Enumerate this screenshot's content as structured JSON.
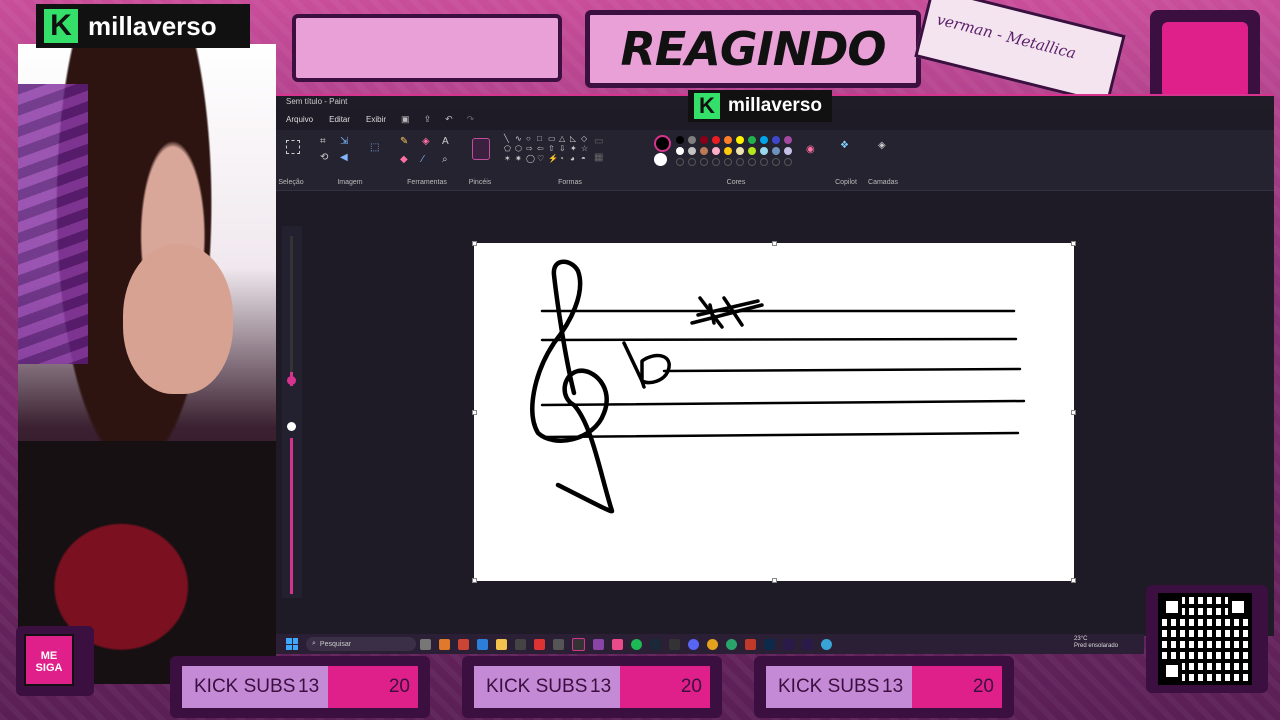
{
  "overlay": {
    "brand": "millaverso",
    "banner": "REAGINDO",
    "sticker_text": "verman - Metallica",
    "me_siga": "ME SIGA",
    "subs": [
      {
        "label": "KICK SUBS",
        "count": "13",
        "goal": "20"
      },
      {
        "label": "KICK SUBS",
        "count": "13",
        "goal": "20"
      },
      {
        "label": "KICK SUBS",
        "count": "13",
        "goal": "20"
      }
    ],
    "colors": {
      "accent": "#e0208a",
      "frame": "#3b0f3f",
      "panel": "#e9a0d6",
      "kick_green": "#35e06a"
    }
  },
  "paint": {
    "title": "Sem título - Paint",
    "menu": [
      "Arquivo",
      "Editar",
      "Exibir"
    ],
    "ribbon_groups": [
      "Seleção",
      "Imagem",
      "Ferramentas",
      "Pincéis",
      "Formas",
      "Cores",
      "Copilot",
      "Camadas"
    ],
    "palette": [
      "#000000",
      "#7f7f7f",
      "#880015",
      "#ed1c24",
      "#ff7f27",
      "#fff200",
      "#22b14c",
      "#00a2e8",
      "#3f48cc",
      "#a349a4",
      "#ffffff",
      "#c3c3c3",
      "#b97a57",
      "#ffaec9",
      "#ffc90e",
      "#efe4b0",
      "#b5e61d",
      "#99d9ea",
      "#7092be",
      "#c8bfe7"
    ],
    "icons": [
      "selection-icon",
      "crop-icon",
      "resize-icon",
      "rotate-icon",
      "pencil-icon",
      "fill-icon",
      "text-icon",
      "eraser-icon",
      "color-picker-icon",
      "zoom-icon",
      "brush-icon",
      "copilot-icon",
      "layers-icon",
      "undo-icon",
      "redo-icon",
      "save-icon"
    ]
  },
  "taskbar": {
    "search_placeholder": "Pesquisar",
    "weather_temp": "23°C",
    "weather_desc": "Pred ensolarado"
  }
}
